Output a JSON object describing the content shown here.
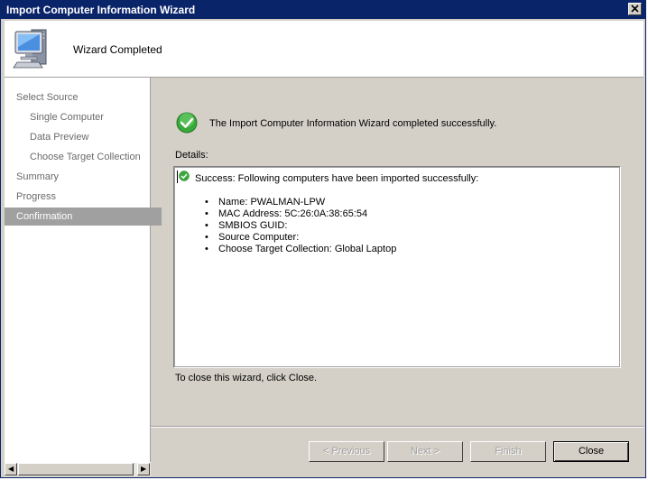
{
  "window": {
    "title": "Import Computer Information Wizard"
  },
  "header": {
    "title": "Wizard Completed",
    "icon": "computer-icon"
  },
  "nav": {
    "items": [
      {
        "label": "Select Source",
        "level": 0,
        "selected": false
      },
      {
        "label": "Single Computer",
        "level": 1,
        "selected": false
      },
      {
        "label": "Data Preview",
        "level": 1,
        "selected": false
      },
      {
        "label": "Choose Target Collection",
        "level": 1,
        "selected": false
      },
      {
        "label": "Summary",
        "level": 0,
        "selected": false
      },
      {
        "label": "Progress",
        "level": 0,
        "selected": false
      },
      {
        "label": "Confirmation",
        "level": 0,
        "selected": true
      }
    ]
  },
  "content": {
    "success_message": "The Import Computer Information Wizard completed successfully.",
    "details_label": "Details:",
    "details_heading": "Success: Following computers have been imported successfully:",
    "details_items": [
      "Name: PWALMAN-LPW",
      "MAC Address: 5C:26:0A:38:65:54",
      "SMBIOS GUID:",
      "Source Computer:",
      "Choose Target Collection: Global Laptop"
    ],
    "close_hint": "To close this wizard, click Close."
  },
  "buttons": {
    "previous": "< Previous",
    "next": "Next >",
    "finish": "Finish",
    "close": "Close"
  },
  "colors": {
    "titlebar": "#0a246a",
    "selected_nav": "#a0a0a0",
    "success_green": "#3aa83a"
  }
}
